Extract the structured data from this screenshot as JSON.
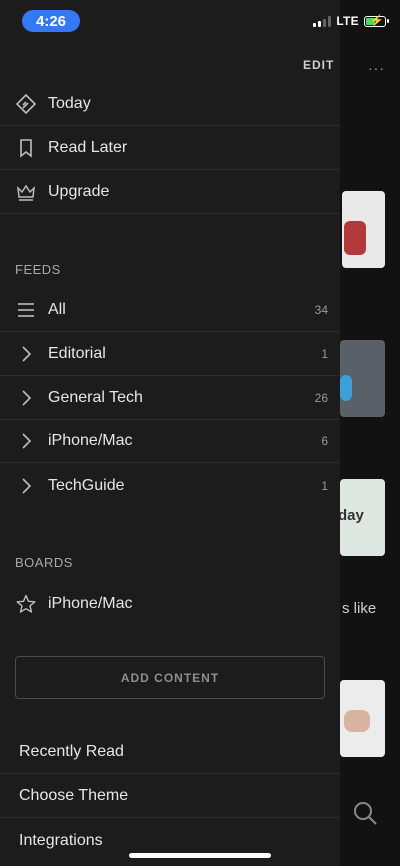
{
  "status": {
    "time": "4:26",
    "network": "LTE"
  },
  "header": {
    "edit_label": "EDIT",
    "more_label": "···"
  },
  "nav": [
    {
      "label": "Today",
      "icon": "feedly-icon"
    },
    {
      "label": "Read Later",
      "icon": "bookmark-icon"
    },
    {
      "label": "Upgrade",
      "icon": "crown-icon"
    }
  ],
  "feeds": {
    "heading": "FEEDS",
    "items": [
      {
        "label": "All",
        "count": "34",
        "icon": "list-icon"
      },
      {
        "label": "Editorial",
        "count": "1",
        "icon": "chevron-right-icon"
      },
      {
        "label": "General Tech",
        "count": "26",
        "icon": "chevron-right-icon"
      },
      {
        "label": "iPhone/Mac",
        "count": "6",
        "icon": "chevron-right-icon"
      },
      {
        "label": "TechGuide",
        "count": "1",
        "icon": "chevron-right-icon"
      }
    ]
  },
  "boards": {
    "heading": "BOARDS",
    "items": [
      {
        "label": "iPhone/Mac",
        "icon": "star-icon"
      }
    ]
  },
  "add_content_label": "ADD CONTENT",
  "menu": [
    {
      "label": "Recently Read"
    },
    {
      "label": "Choose Theme"
    },
    {
      "label": "Integrations"
    }
  ],
  "background": {
    "fragment_day": "day",
    "fragment_like": "s like"
  },
  "colors": {
    "time_pill": "#3478f6",
    "drawer_bg": "#1c1c1c",
    "battery": "#4cd964"
  }
}
